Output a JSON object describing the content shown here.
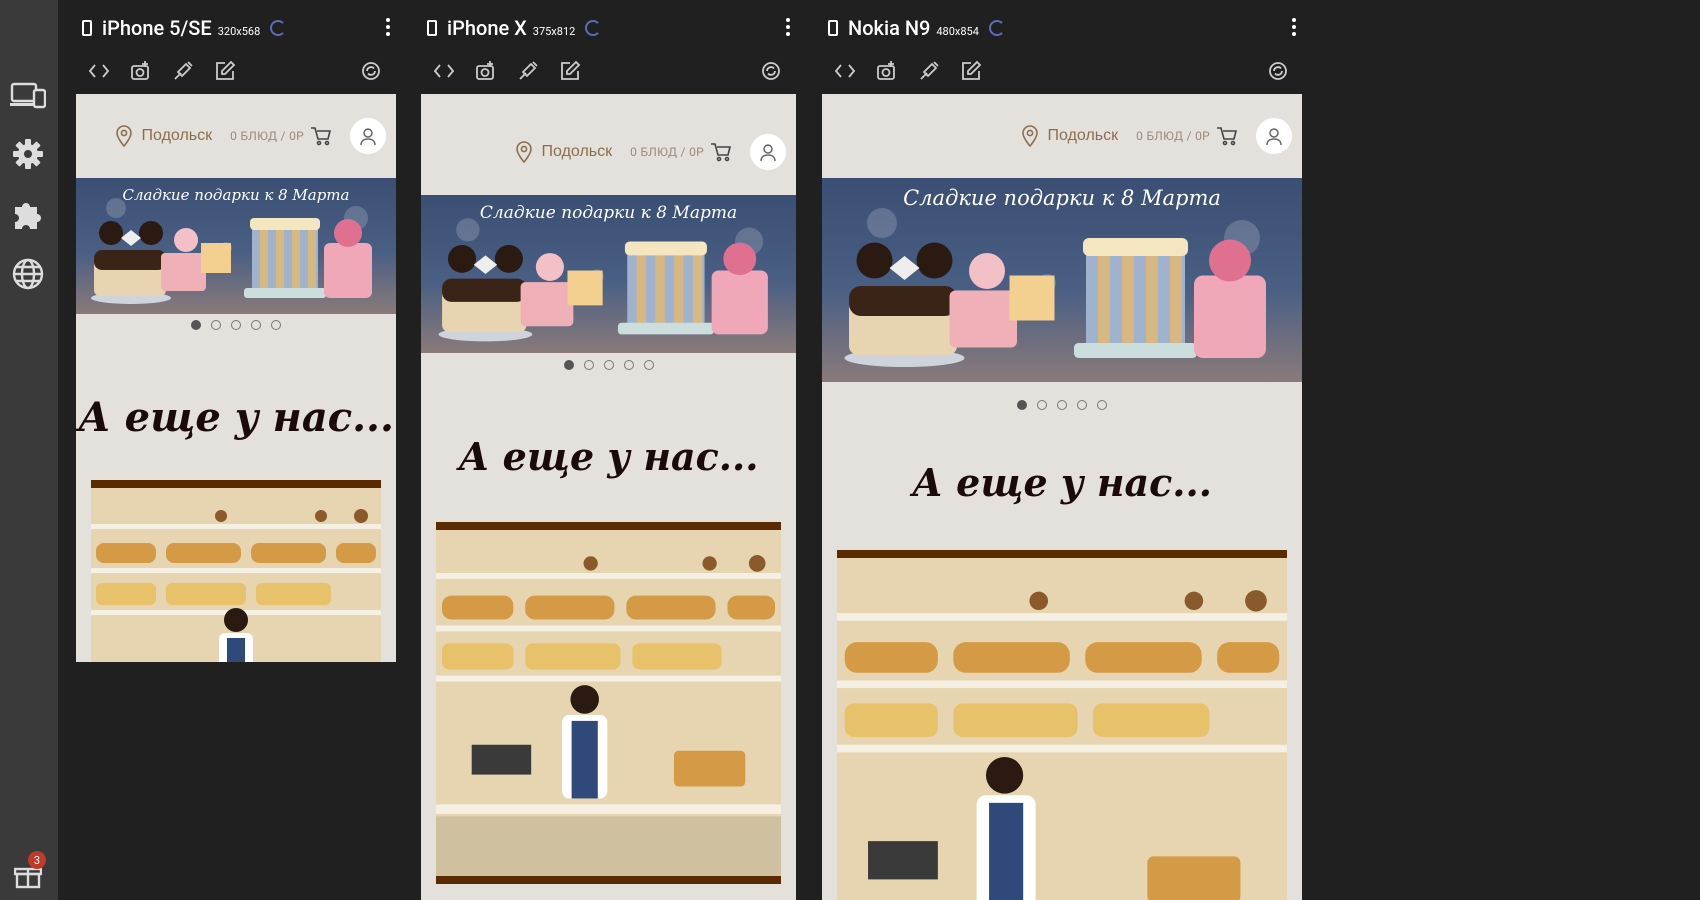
{
  "sidebar": {
    "icons": [
      "devices-icon",
      "gear-icon",
      "puzzle-icon",
      "globe-icon",
      "gift-icon"
    ],
    "gift_badge": "3"
  },
  "devices": [
    {
      "name": "iPhone 5/SE",
      "size": "320x568"
    },
    {
      "name": "iPhone X",
      "size": "375x812"
    },
    {
      "name": "Nokia N9",
      "size": "480x854"
    }
  ],
  "site": {
    "city": "Подольск",
    "cart": "0 БЛЮД / 0Р",
    "banner_title": "Сладкие подарки к 8 Марта",
    "section_heading": "А еще у нас...",
    "slides": 5,
    "active_slide": 1
  },
  "colors": {
    "accent": "#5c6bc0",
    "page_bg": "#e4e1dd",
    "city_text": "#8d6e4e",
    "photo_border": "#5a2a00"
  }
}
